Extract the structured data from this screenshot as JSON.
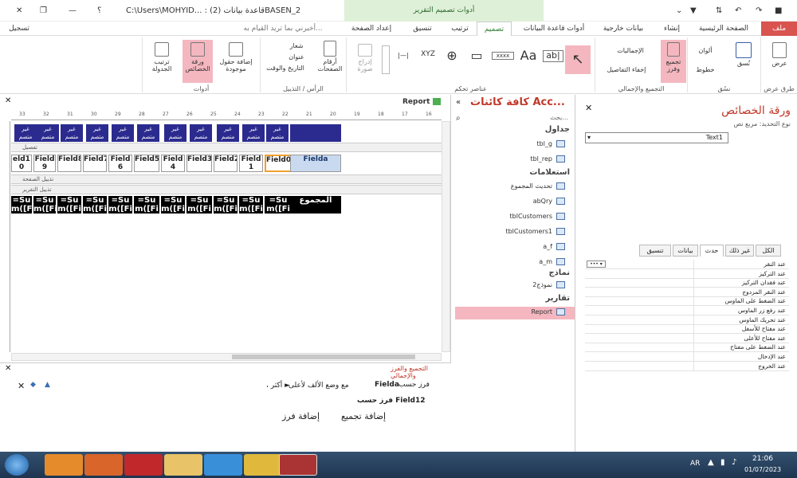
{
  "titlebar": {
    "path": "C:\\Users\\MOHYID... : قاعدة بيانات (2)BASEN_2",
    "contextual": "أدوات تصميم التقرير",
    "help": "؟"
  },
  "tabs": {
    "file": "ملف",
    "home": "الصفحة الرئيسية",
    "create": "إنشاء",
    "external": "بيانات خارجية",
    "dbtools": "أدوات قاعدة البيانات",
    "design": "تصميم",
    "arrange": "ترتيب",
    "format": "تنسيق",
    "pagesetup": "إعداد الصفحة",
    "tellme": "أخبرني بما تريد القيام به...",
    "signin": "تسجيل الدخول"
  },
  "ribbon": {
    "views": {
      "view": "عرض",
      "group": "طرق عرض"
    },
    "themes": {
      "themes": "نُسق",
      "colors": "ألوان",
      "fonts": "خطوط",
      "group": "نسُق"
    },
    "grouping": {
      "groupsort": "تجميع وفرز",
      "totals": "الإجماليات",
      "hide": "إخفاء التفاصيل",
      "group": "التجميع والإجمالي"
    },
    "controls": {
      "group": "عناصر تحكم",
      "insert_image": "إدراج صورة",
      "aa": "Aa",
      "ab": "ab|",
      "xyz": "XYZ",
      "xxxx": "xxxx"
    },
    "header": {
      "page_numbers": "أرقام الصفحات",
      "logo": "شعار",
      "title": "عنوان",
      "datetime": "التاريخ والوقت",
      "group": "الرأس / التذييل"
    },
    "tools": {
      "add_fields": "إضافة حقول موجودة",
      "property_sheet": "ورقة الخصائص",
      "tab_order": "ترتيب الجدولة",
      "group": "أدوات"
    }
  },
  "report": {
    "tab": "Report",
    "ruler": [
      "16",
      "17",
      "18",
      "19",
      "20",
      "21",
      "22",
      "23",
      "24",
      "25",
      "26",
      "27",
      "28",
      "29",
      "30",
      "31",
      "32",
      "33"
    ],
    "header_cell": "غير\nمتصم",
    "sections": {
      "detail": "تفصيل",
      "page_footer": "تذييل الصفحة",
      "report_footer": "تذييل التقرير"
    },
    "fields": [
      "eld1\n0",
      "Field\n9",
      "Field8",
      "Field7",
      "Field\n6",
      "Field5",
      "Field\n4",
      "Field3",
      "Field2",
      "Field\n1",
      "Field0",
      "Fielda"
    ],
    "sums": [
      "=Su\nm([Fi",
      "=Su\nm([Fi",
      "=Su\nm([Fi",
      "=Su\nm([Fi",
      "=Su\nm([Fi",
      "=Su\nm([Fi",
      "=Su\nm([Fi",
      "=Su\nm([Fi",
      "=Su\nm([Fi",
      "=Su\nm([Fi",
      "=Su\nm([Fi",
      "المجموع"
    ]
  },
  "grouping_pane": {
    "title": "التجميع والفرز والإجمالي",
    "sort_by": "فرز حسب",
    "field": "Fielda",
    "order": "مع وضع الألف لأعلى",
    "more": "، أكثر ►",
    "sort_by2": "فرز حسب Field12",
    "add_group": "إضافة تجميع",
    "add_sort": "إضافة فرز"
  },
  "nav": {
    "title": "كافة كائنات Acc...",
    "search": "بحث...",
    "tables": "جداول",
    "queries": "استعلامات",
    "forms": "نماذج",
    "reports": "تقارير",
    "table_items": [
      "tbl_g",
      "tbl_rep"
    ],
    "query_items": [
      "تحديث المجموع",
      "abQry",
      "tblCustomers",
      "tblCustomers1",
      "a_f",
      "a_m"
    ],
    "form_items": [
      "نموذج2"
    ],
    "report_items": [
      "Report"
    ]
  },
  "props": {
    "title": "ورقة الخصائص",
    "selection_type": "نوع التحديد: مربع نص",
    "selected": "Text1",
    "tabs": [
      "الكل",
      "غير ذلك",
      "حدث",
      "بيانات",
      "تنسيق"
    ],
    "rows": [
      "عند النقر",
      "عند التركيز",
      "عند فقدان التركيز",
      "عند النقر المزدوج",
      "عند الضغط على الماوس",
      "عند رفع زر الماوس",
      "عند تحريك الماوس",
      "عند مفتاح للأسفل",
      "عند مفتاح للأعلى",
      "عند الضغط على مفتاح",
      "عند الإدخال",
      "عند الخروج"
    ]
  },
  "taskbar": {
    "lang": "AR",
    "time": "21:06",
    "date": "01/07/2023"
  },
  "colors": {
    "file": "#d9534f",
    "highlight": "#f4b7c0",
    "header": "#2b2b8f",
    "accent": "#2e7d32"
  }
}
